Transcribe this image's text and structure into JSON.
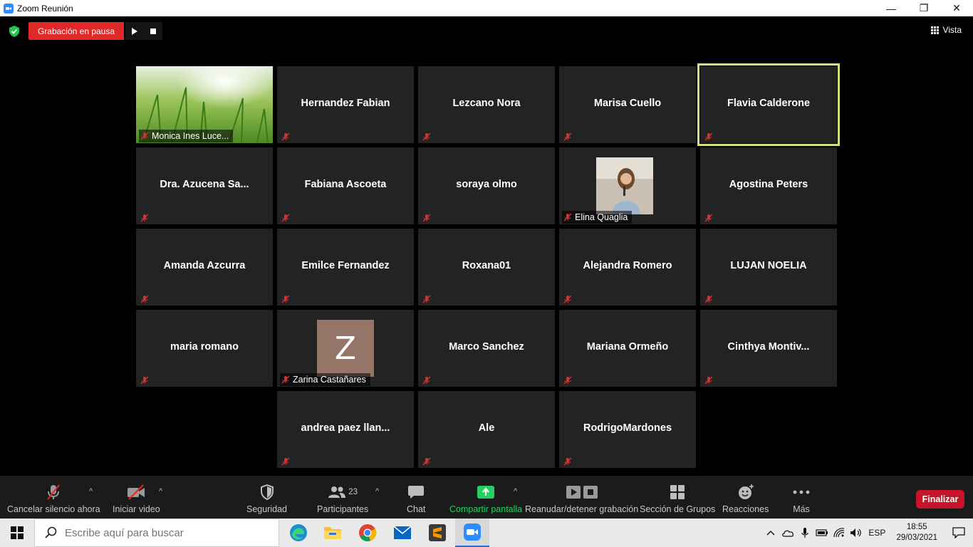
{
  "window": {
    "title": "Zoom Reunión",
    "minimize": "—",
    "maximize": "❐",
    "close": "✕"
  },
  "top_bar": {
    "recording_status": "Grabación en pausa",
    "view_label": "Vista"
  },
  "participants": [
    {
      "name": "Monica Ines Luce...",
      "style": "video"
    },
    {
      "name": "Hernandez Fabian"
    },
    {
      "name": "Lezcano Nora"
    },
    {
      "name": "Marisa Cuello"
    },
    {
      "name": "Flavia Calderone",
      "active": true
    },
    {
      "name": "Dra.  Azucena  Sa..."
    },
    {
      "name": "Fabiana Ascoeta"
    },
    {
      "name": "soraya olmo"
    },
    {
      "name": "Elina Quaglia",
      "style": "photo"
    },
    {
      "name": "Agostina Peters"
    },
    {
      "name": "Amanda Azcurra"
    },
    {
      "name": "Emilce Fernandez"
    },
    {
      "name": "Roxana01"
    },
    {
      "name": "Alejandra Romero"
    },
    {
      "name": "LUJAN NOELIA"
    },
    {
      "name": "maria romano"
    },
    {
      "name": "Zarina Castañares",
      "style": "avatar",
      "initial": "Z"
    },
    {
      "name": "Marco Sanchez"
    },
    {
      "name": "Mariana Ormeño"
    },
    {
      "name": "Cinthya  Montiv..."
    },
    {
      "name": "andrea  paez  llan..."
    },
    {
      "name": "Ale"
    },
    {
      "name": "RodrigoMardones"
    }
  ],
  "toolbar": {
    "mute_label": "Cancelar silencio ahora",
    "video_label": "Iniciar video",
    "security_label": "Seguridad",
    "participants_label": "Participantes",
    "participants_count": "23",
    "chat_label": "Chat",
    "share_label": "Compartir pantalla",
    "recording_label": "Reanudar/detener grabación",
    "breakout_label": "Sección de Grupos",
    "reactions_label": "Reacciones",
    "more_label": "Más",
    "end_label": "Finalizar"
  },
  "taskbar": {
    "search_placeholder": "Escribe aquí para buscar",
    "language": "ESP",
    "time": "18:55",
    "date": "29/03/2021"
  },
  "colors": {
    "accent_red": "#e02828",
    "share_green": "#23d160",
    "active_speaker": "#d5e07a",
    "end_button": "#c6152a"
  }
}
